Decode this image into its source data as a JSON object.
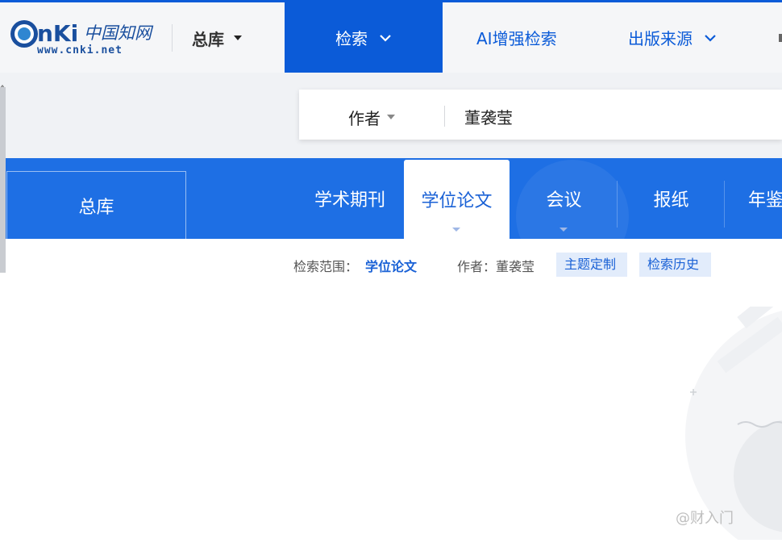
{
  "header": {
    "logo": {
      "wordmark": "CNKi",
      "cn_text": "中国知网",
      "url_text": "www.cnki.net"
    },
    "database_select": {
      "label": "总库"
    },
    "nav": [
      {
        "label": "检索",
        "active": true,
        "dropdown": true
      },
      {
        "label": "AI增强检索",
        "active": false,
        "dropdown": false
      },
      {
        "label": "出版来源",
        "active": false,
        "dropdown": true
      }
    ]
  },
  "search": {
    "field": "作者",
    "query": "董袭莹"
  },
  "tabs": {
    "all": "总库",
    "items": [
      {
        "label": "学术期刊",
        "active": false
      },
      {
        "label": "学位论文",
        "active": true
      },
      {
        "label": "会议",
        "active": false
      },
      {
        "label": "报纸",
        "active": false
      },
      {
        "label": "年鉴",
        "active": false
      }
    ]
  },
  "scope": {
    "label": "检索范围：",
    "value": "学位论文",
    "author": "作者：董袭莹",
    "topic_button": "主题定制",
    "history_button": "检索历史"
  },
  "watermark": "@财入门",
  "colors": {
    "primary": "#0b5bd8",
    "tabbar": "#1e6fe4",
    "chip_bg": "#e2ecfb"
  }
}
